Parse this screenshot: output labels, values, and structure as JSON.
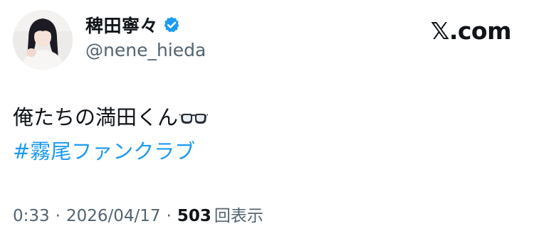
{
  "author": {
    "display_name": "稗田寧々",
    "handle": "@nene_hieda",
    "verified_icon": "verified-badge-icon",
    "verified_color": "#1d9bf0",
    "avatar_icon": "profile-photo"
  },
  "brand": {
    "logo_text": "𝕏.com"
  },
  "tweet": {
    "text": "俺たちの満田くん",
    "emoji_icon": "glasses-icon",
    "hashtag": "#霧尾ファンクラブ",
    "hashtag_color": "#1d9bf0"
  },
  "meta": {
    "time": "0:33",
    "separator": "·",
    "date": "2026/04/17",
    "views_count": "503",
    "views_label": "回表示"
  }
}
